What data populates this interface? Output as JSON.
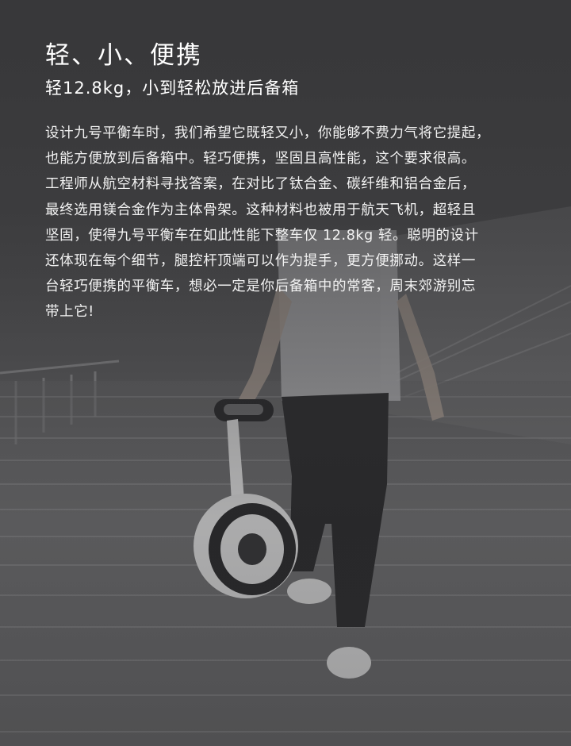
{
  "hero": {
    "title": "轻、小、便携",
    "subtitle": "轻12.8kg，小到轻松放进后备箱",
    "body_lines": [
      "设计九号平衡车时，我们希望它既轻又小，你能够不费力气将它提起，",
      "也能方便放到后备箱中。轻巧便携，坚固且高性能，这个要求很高。",
      "工程师从航空材料寻找答案，在对比了钛合金、碳纤维和铝合金后，",
      "最终选用镁合金作为主体骨架。这种材料也被用于航天飞机，超轻且",
      "坚固，使得九号平衡车在如此性能下整车仅 12.8kg 轻。聪明的设计",
      "还体现在每个细节，腿控杆顶端可以作为提手，更方便挪动。这样一",
      "台轻巧便携的平衡车，想必一定是你后备箱中的常客，周末郊游别忘",
      "带上它!"
    ]
  },
  "colors": {
    "background": "#3f3f41",
    "text": "#ffffff"
  }
}
